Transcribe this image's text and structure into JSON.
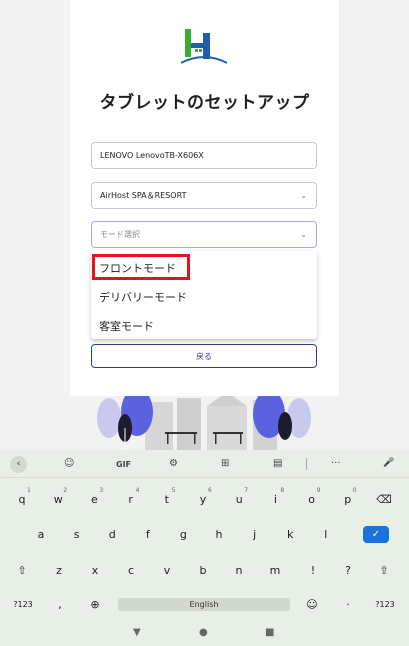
{
  "page": {
    "title": "タブレットのセットアップ",
    "device_name_value": "LENOVO LenovoTB-X606X",
    "hotel_select_value": "AirHost SPA＆RESORT",
    "mode_select_placeholder": "モード選択",
    "mode_options": [
      "フロントモード",
      "デリバリーモード",
      "客室モード"
    ],
    "highlighted_option_index": 0,
    "back_button_label": "戻る"
  },
  "keyboard": {
    "toolbar": {
      "back_icon": "‹",
      "sticker_icon": "☺",
      "gif_label": "GIF",
      "settings_icon": "⚙",
      "translate_icon": "⊞",
      "clipboard_icon": "▤",
      "more_icon": "···",
      "mic_icon": "🎤"
    },
    "row1": [
      "q",
      "w",
      "e",
      "r",
      "t",
      "y",
      "u",
      "i",
      "o",
      "p"
    ],
    "row1_hints": [
      "1",
      "2",
      "3",
      "4",
      "5",
      "6",
      "7",
      "8",
      "9",
      "0"
    ],
    "row1_end": "⌫",
    "row2": [
      "a",
      "s",
      "d",
      "f",
      "g",
      "h",
      "j",
      "k",
      "l"
    ],
    "enter_icon": "✓",
    "shift_left": "⇧",
    "row3": [
      "z",
      "x",
      "c",
      "v",
      "b",
      "n",
      "m"
    ],
    "row3_punct": [
      "!",
      "?"
    ],
    "shift_right": "⇧",
    "bottom": {
      "sym_left": "?123",
      "comma": ",",
      "globe": "⊕",
      "space_label": "English",
      "emoji": "☺",
      "period": "·",
      "sym_right": "?123"
    }
  },
  "navbar": {
    "back": "▼",
    "home": "●",
    "recents": "■"
  },
  "colors": {
    "accent": "#2d3c86",
    "highlight": "#e3141b",
    "keyboard_bg": "#e8efe6",
    "enter_key": "#1a73d9"
  }
}
